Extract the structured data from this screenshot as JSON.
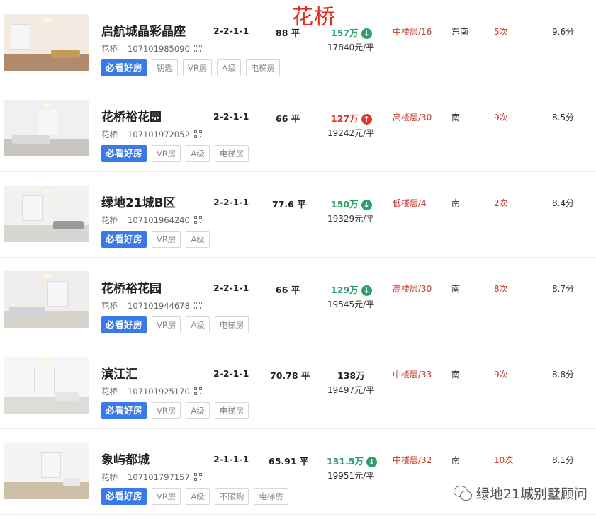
{
  "district_title": "花桥",
  "watermark": "绿地21城别墅顾问",
  "badge_label": "必看好房",
  "listings": [
    {
      "name": "启航城晶彩晶座",
      "district": "花桥",
      "code": "107101985090",
      "layout": "2-2-1-1",
      "area": "88 平",
      "total_price": "157万",
      "trend": "down",
      "unit_price": "17840元/平",
      "floor": "中楼层/16",
      "orientation": "东南",
      "views": "5次",
      "score": "9.6分",
      "tags": [
        "钥匙",
        "VR房",
        "A级",
        "电梯房"
      ]
    },
    {
      "name": "花桥裕花园",
      "district": "花桥",
      "code": "107101972052",
      "layout": "2-2-1-1",
      "area": "66 平",
      "total_price": "127万",
      "trend": "up",
      "unit_price": "19242元/平",
      "floor": "高楼层/30",
      "orientation": "南",
      "views": "9次",
      "score": "8.5分",
      "tags": [
        "VR房",
        "A级",
        "电梯房"
      ]
    },
    {
      "name": "绿地21城B区",
      "district": "花桥",
      "code": "107101964240",
      "layout": "2-2-1-1",
      "area": "77.6 平",
      "total_price": "150万",
      "trend": "down",
      "unit_price": "19329元/平",
      "floor": "低楼层/4",
      "orientation": "南",
      "views": "2次",
      "score": "8.4分",
      "tags": [
        "VR房",
        "A级"
      ]
    },
    {
      "name": "花桥裕花园",
      "district": "花桥",
      "code": "107101944678",
      "layout": "2-2-1-1",
      "area": "66 平",
      "total_price": "129万",
      "trend": "down",
      "unit_price": "19545元/平",
      "floor": "高楼层/30",
      "orientation": "南",
      "views": "8次",
      "score": "8.7分",
      "tags": [
        "VR房",
        "A级",
        "电梯房"
      ]
    },
    {
      "name": "滨江汇",
      "district": "花桥",
      "code": "107101925170",
      "layout": "2-2-1-1",
      "area": "70.78 平",
      "total_price": "138万",
      "trend": "none",
      "unit_price": "19497元/平",
      "floor": "中楼层/33",
      "orientation": "南",
      "views": "9次",
      "score": "8.8分",
      "tags": [
        "VR房",
        "A级",
        "电梯房"
      ]
    },
    {
      "name": "象屿都城",
      "district": "花桥",
      "code": "107101797157",
      "layout": "2-1-1-1",
      "area": "65.91 平",
      "total_price": "131.5万",
      "trend": "down",
      "unit_price": "19951元/平",
      "floor": "中楼层/32",
      "orientation": "南",
      "views": "10次",
      "score": "8.1分",
      "tags": [
        "VR房",
        "A级",
        "不限购",
        "电梯房"
      ]
    }
  ],
  "colors": {
    "price_down": "#2e9e6a",
    "price_up": "#d93a2f",
    "badge": "#3a79e8",
    "floor_text": "#c23b2e",
    "title_red": "#e12b1c"
  }
}
